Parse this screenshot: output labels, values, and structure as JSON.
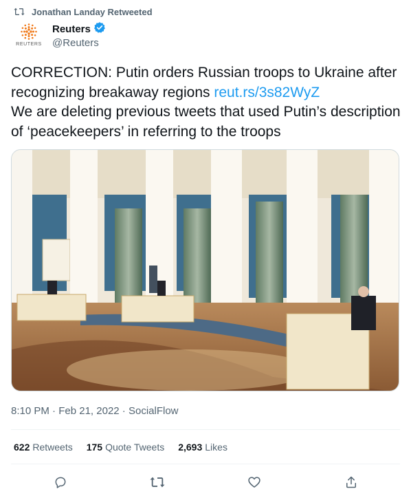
{
  "retweet_context": {
    "icon": "retweet-icon",
    "label": "Jonathan Landay Retweeted"
  },
  "author": {
    "avatar_brand": "REUTERS",
    "display_name": "Reuters",
    "verified_icon": "verified-badge-icon",
    "handle": "@Reuters"
  },
  "tweet": {
    "text_line1": "CORRECTION: Putin orders Russian troops to Ukraine after recognizing breakaway regions ",
    "link": "reut.rs/3s82WyZ",
    "text_line2": "We are deleting previous tweets that used Putin’s description of ‘peacekeepers’ in referring to the troops"
  },
  "media": {
    "alt": ""
  },
  "meta": {
    "time": "8:10 PM",
    "sep1": " · ",
    "date": "Feb 21, 2022",
    "sep2": " · ",
    "source": "SocialFlow"
  },
  "stats": {
    "retweets_count": "622",
    "retweets_label": "Retweets",
    "quotes_count": "175",
    "quotes_label": "Quote Tweets",
    "likes_count": "2,693",
    "likes_label": "Likes"
  },
  "actions": [
    "reply-icon",
    "retweet-icon",
    "like-icon",
    "share-icon"
  ],
  "colors": {
    "link": "#1d9bf0",
    "secondary_text": "#536471",
    "verified": "#1d9bf0",
    "divider": "#eff3f4"
  }
}
